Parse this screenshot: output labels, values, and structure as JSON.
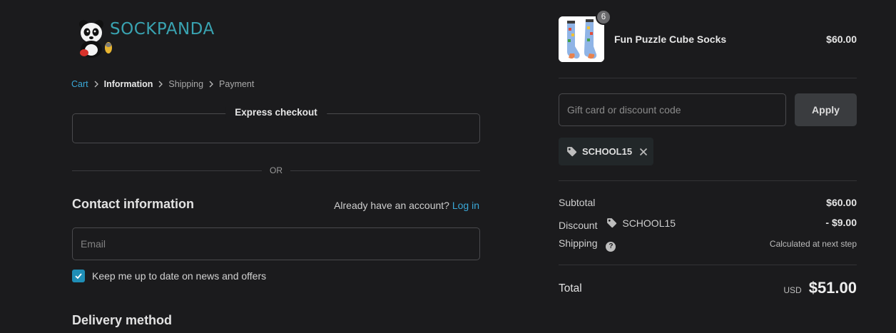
{
  "brand": {
    "name": "SOCKPANDA",
    "accent_color": "#39a3b1"
  },
  "breadcrumb": {
    "items": [
      {
        "label": "Cart",
        "state": "link"
      },
      {
        "label": "Information",
        "state": "current"
      },
      {
        "label": "Shipping",
        "state": "upcoming"
      },
      {
        "label": "Payment",
        "state": "upcoming"
      }
    ]
  },
  "express_checkout": {
    "label": "Express checkout",
    "divider_text": "OR"
  },
  "contact": {
    "heading": "Contact information",
    "account_prompt": "Already have an account?",
    "login_label": "Log in",
    "email_placeholder": "Email",
    "newsletter_label": "Keep me up to date on news and offers",
    "newsletter_checked": true
  },
  "delivery": {
    "heading": "Delivery method"
  },
  "cart": {
    "items": [
      {
        "name": "Fun Puzzle Cube Socks",
        "quantity": "6",
        "price": "$60.00",
        "thumbnail_icon": "socks-image"
      }
    ]
  },
  "discount": {
    "placeholder": "Gift card or discount code",
    "apply_label": "Apply",
    "applied_code": "SCHOOL15"
  },
  "summary": {
    "subtotal_label": "Subtotal",
    "subtotal_value": "$60.00",
    "discount_label": "Discount",
    "discount_code": "SCHOOL15",
    "discount_value": "- $9.00",
    "shipping_label": "Shipping",
    "shipping_value": "Calculated at next step",
    "total_label": "Total",
    "currency": "USD",
    "total_value": "$51.00"
  },
  "colors": {
    "background": "#1b1b1d",
    "link": "#3aa8d8",
    "checkbox": "#1f8eb6"
  }
}
